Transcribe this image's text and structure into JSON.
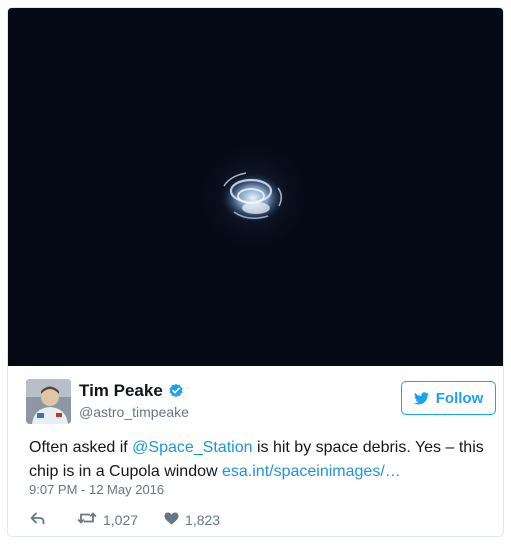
{
  "tweet": {
    "display_name": "Tim Peake",
    "handle": "@astro_timpeake",
    "follow_label": "Follow",
    "text_before": "Often asked if ",
    "mention": "@Space_Station",
    "text_middle": " is hit by space debris. Yes – this chip is in a Cupola window ",
    "url": "esa.int/spaceinimages/…",
    "timestamp": "9:07 PM - 12 May 2016",
    "retweets": "1,027",
    "likes": "1,823"
  },
  "icons": {
    "verified": "verified-badge-icon",
    "follow": "bird-icon",
    "reply": "reply-icon",
    "retweet": "retweet-icon",
    "like": "heart-icon"
  },
  "colors": {
    "accent": "#1da1f2",
    "link": "#1b95e0",
    "secondary_text": "#657786",
    "photo_background": "#060a16"
  }
}
